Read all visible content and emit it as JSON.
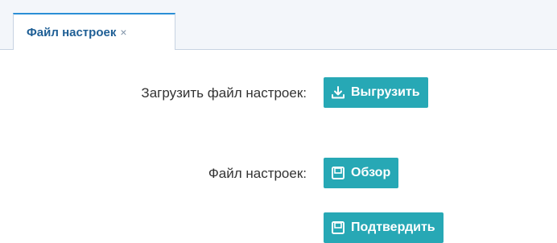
{
  "tabs": [
    {
      "label": "Файл настроек",
      "close_glyph": "×"
    }
  ],
  "form": {
    "upload_label": "Загрузить файл настроек:",
    "upload_button": "Выгрузить",
    "file_label": "Файл настроек:",
    "browse_button": "Обзор",
    "confirm_button": "Подтвердить"
  },
  "icons": {
    "upload_icon": "download-icon",
    "browse_icon": "floppy-disk-icon",
    "confirm_icon": "floppy-disk-icon"
  },
  "colors": {
    "button_bg": "#27a8b5",
    "tab_accent": "#2a8fd6",
    "tab_text": "#1f5f95"
  }
}
